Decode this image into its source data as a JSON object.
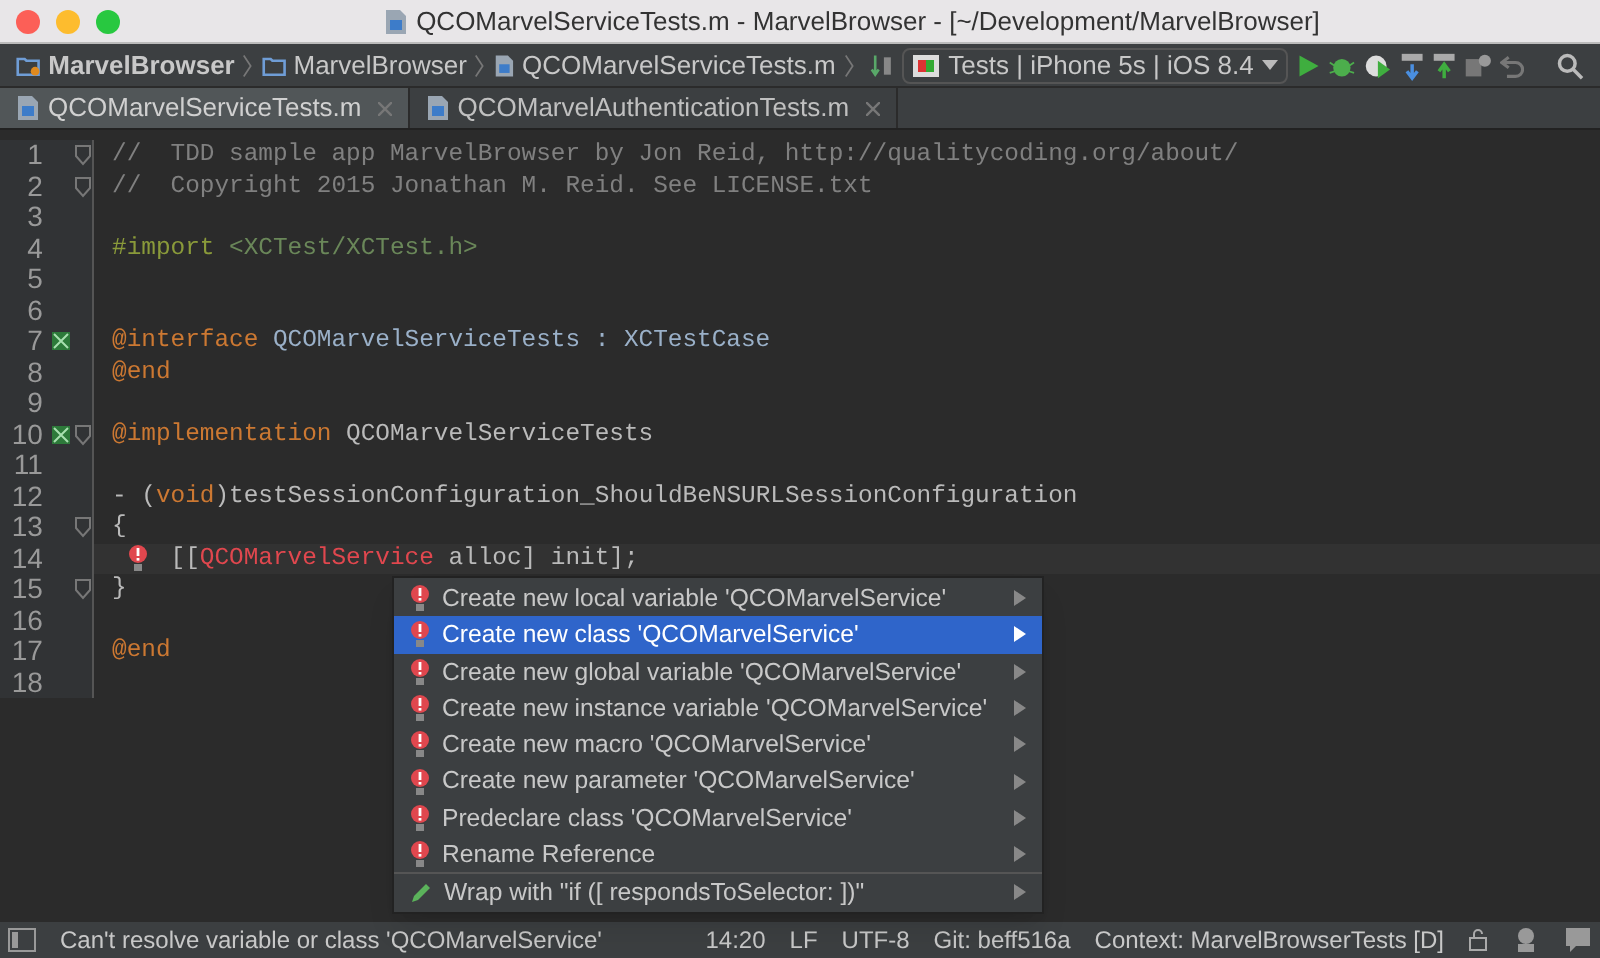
{
  "window": {
    "title": "QCOMarvelServiceTests.m - MarvelBrowser - [~/Development/MarvelBrowser]"
  },
  "breadcrumbs": [
    "MarvelBrowser",
    "MarvelBrowser",
    "QCOMarvelServiceTests.m"
  ],
  "run_config": "Tests | iPhone 5s | iOS 8.4",
  "tabs": [
    {
      "label": "QCOMarvelServiceTests.m",
      "selected": true
    },
    {
      "label": "QCOMarvelAuthenticationTests.m",
      "selected": false
    }
  ],
  "editor": {
    "lines": [
      {
        "number": "1",
        "fold": true,
        "tokens": [
          {
            "text": "//  TDD sample app MarvelBrowser by Jon Reid, http://qualitycoding.org/about/",
            "kind": "comment"
          }
        ]
      },
      {
        "number": "2",
        "fold": true,
        "tokens": [
          {
            "text": "//  Copyright 2015 Jonathan M. Reid. See LICENSE.txt",
            "kind": "comment"
          }
        ]
      },
      {
        "number": "3"
      },
      {
        "number": "4",
        "tokens": [
          {
            "text": "#import ",
            "kind": "directive"
          },
          {
            "text": "<XCTest/XCTest.h>",
            "kind": "string"
          }
        ]
      },
      {
        "number": "5"
      },
      {
        "number": "6"
      },
      {
        "number": "7",
        "marker": true,
        "tokens": [
          {
            "text": "@interface ",
            "kind": "keyword"
          },
          {
            "text": "QCOMarvelServiceTests : XCTestCase",
            "kind": "type"
          }
        ]
      },
      {
        "number": "8",
        "tokens": [
          {
            "text": "@end",
            "kind": "keyword"
          }
        ]
      },
      {
        "number": "9"
      },
      {
        "number": "10",
        "marker": true,
        "fold": true,
        "tokens": [
          {
            "text": "@implementation ",
            "kind": "keyword"
          },
          {
            "text": "QCOMarvelServiceTests",
            "kind": "plain"
          }
        ]
      },
      {
        "number": "11"
      },
      {
        "number": "12",
        "tokens": [
          {
            "text": "- (",
            "kind": "plain"
          },
          {
            "text": "void",
            "kind": "keyword"
          },
          {
            "text": ")testSessionConfiguration_ShouldBeNSURLSessionConfiguration",
            "kind": "plain"
          }
        ]
      },
      {
        "number": "13",
        "fold": true,
        "tokens": [
          {
            "text": "{",
            "kind": "plain"
          }
        ]
      },
      {
        "number": "14",
        "current": true,
        "bulb": true,
        "tokens": [
          {
            "text": "    [[",
            "kind": "plain"
          },
          {
            "text": "QCOMarvelService",
            "kind": "error"
          },
          {
            "text": " alloc] init];",
            "kind": "plain"
          }
        ]
      },
      {
        "number": "15",
        "fold": true,
        "tokens": [
          {
            "text": "}",
            "kind": "plain"
          }
        ]
      },
      {
        "number": "16"
      },
      {
        "number": "17",
        "tokens": [
          {
            "text": "@end",
            "kind": "keyword"
          }
        ]
      },
      {
        "number": "18"
      }
    ]
  },
  "popup": {
    "items": [
      {
        "label": "Create new local variable 'QCOMarvelService'",
        "kind": "fix",
        "selected": false
      },
      {
        "label": "Create new class 'QCOMarvelService'",
        "kind": "fix",
        "selected": true
      },
      {
        "label": "Create new global variable 'QCOMarvelService'",
        "kind": "fix",
        "selected": false
      },
      {
        "label": "Create new instance variable 'QCOMarvelService'",
        "kind": "fix",
        "selected": false
      },
      {
        "label": "Create new macro 'QCOMarvelService'",
        "kind": "fix",
        "selected": false
      },
      {
        "label": "Create new parameter 'QCOMarvelService'",
        "kind": "fix",
        "selected": false
      },
      {
        "label": "Predeclare class 'QCOMarvelService'",
        "kind": "fix",
        "selected": false
      },
      {
        "label": "Rename Reference",
        "kind": "fix",
        "selected": false
      },
      {
        "label": "Wrap with \"if ([ respondsToSelector: ])\"",
        "kind": "intention",
        "selected": false
      }
    ]
  },
  "status_bar": {
    "message": "Can't resolve variable or class 'QCOMarvelService'",
    "position": "14:20",
    "line_separator": "LF",
    "encoding": "UTF-8",
    "git": "Git: beff516a",
    "context": "Context: MarvelBrowserTests [D]"
  }
}
